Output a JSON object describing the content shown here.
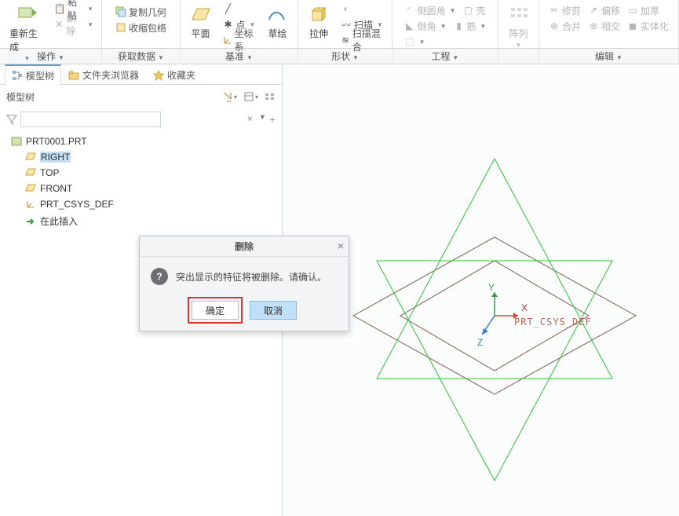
{
  "ribbon": {
    "groups": [
      {
        "name": "操作",
        "label": "操作",
        "items": {
          "regen": "重新生成",
          "paste": "粘贴",
          "copygeo": "复制几何",
          "delete": "删除",
          "shrinkwrap": "收缩包络"
        }
      },
      {
        "name": "获取数据",
        "label": "获取数据"
      },
      {
        "name": "基准",
        "label": "基准",
        "items": {
          "plane": "平面",
          "sketch": "草绘",
          "point": "点",
          "csys": "坐标系"
        }
      },
      {
        "name": "形状",
        "label": "形状",
        "items": {
          "extrude": "拉伸",
          "sweep": "扫描",
          "sweepblend": "扫描混合"
        }
      },
      {
        "name": "工程",
        "label": "工程",
        "items": {
          "round": "倒圆角",
          "shell": "壳",
          "chamfer": "倒角",
          "rib": "筋"
        }
      },
      {
        "name": "阵列",
        "label": "阵列",
        "big": "阵列"
      },
      {
        "name": "编辑",
        "label": "编辑",
        "items": {
          "trim": "修剪",
          "offset": "偏移",
          "thicken": "加厚",
          "merge": "合并",
          "intersect": "相交",
          "solidify": "实体化"
        }
      }
    ]
  },
  "panel": {
    "tabs": {
      "model_tree": "模型树",
      "folder": "文件夹浏览器",
      "favorites": "收藏夹"
    },
    "tree_title": "模型树",
    "search_placeholder": ""
  },
  "tree": {
    "root": "PRT0001.PRT",
    "items": [
      {
        "label": "RIGHT",
        "selected": true,
        "kind": "plane"
      },
      {
        "label": "TOP",
        "kind": "plane"
      },
      {
        "label": "FRONT",
        "kind": "plane"
      },
      {
        "label": "PRT_CSYS_DEF",
        "kind": "csys"
      },
      {
        "label": "在此插入",
        "kind": "insert"
      }
    ]
  },
  "dialog": {
    "title": "删除",
    "message": "突出显示的特征将被删除。请确认。",
    "ok": "确定",
    "cancel": "取消"
  },
  "viewport": {
    "csys_label": "PRT_CSYS_DEF",
    "axes": {
      "x": "X",
      "y": "Y",
      "z": "Z"
    }
  }
}
